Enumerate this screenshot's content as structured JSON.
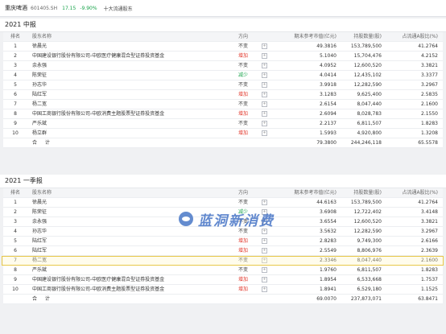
{
  "header": {
    "name": "重庆啤酒",
    "code": "601405.SH",
    "price": "17.15",
    "change": "-9.90%",
    "holder_tab": "十大流通股东"
  },
  "sections": [
    {
      "title": "2021 中报",
      "columns": [
        "排名",
        "股东名称",
        "方向",
        "",
        "期末参考市值(亿元)",
        "持股数量(股)",
        "占流通A股比(%)"
      ],
      "rows": [
        {
          "rank": "1",
          "name": "徐晨光",
          "dir": "不变",
          "type": "unchanged",
          "value": "49.3816",
          "shares": "153,789,500",
          "pct": "41.2764"
        },
        {
          "rank": "2",
          "name": "中国建设银行股份有限公司-中欧医疗健康混合型证券投资基金",
          "dir": "增加",
          "type": "up",
          "value": "5.1040",
          "shares": "15,704,476",
          "pct": "4.2152"
        },
        {
          "rank": "3",
          "name": "余永强",
          "dir": "不变",
          "type": "unchanged",
          "value": "4.0952",
          "shares": "12,600,520",
          "pct": "3.3821"
        },
        {
          "rank": "4",
          "name": "陈荣征",
          "dir": "减少",
          "type": "down",
          "value": "4.0414",
          "shares": "12,435,102",
          "pct": "3.3377"
        },
        {
          "rank": "5",
          "name": "孙志华",
          "dir": "不变",
          "type": "unchanged",
          "value": "3.9918",
          "shares": "12,282,590",
          "pct": "3.2967"
        },
        {
          "rank": "6",
          "name": "陆红军",
          "dir": "增加",
          "type": "up",
          "value": "3.1283",
          "shares": "9,625,400",
          "pct": "2.5835"
        },
        {
          "rank": "7",
          "name": "杨二宽",
          "dir": "不变",
          "type": "unchanged",
          "value": "2.6154",
          "shares": "8,047,440",
          "pct": "2.1600"
        },
        {
          "rank": "8",
          "name": "中国工商银行股份有限公司-中欧消费主题股票型证券投资基金",
          "dir": "增加",
          "type": "up",
          "value": "2.6094",
          "shares": "8,028,783",
          "pct": "2.1550"
        },
        {
          "rank": "9",
          "name": "严乐斌",
          "dir": "不变",
          "type": "unchanged",
          "value": "2.2137",
          "shares": "6,811,507",
          "pct": "1.8283"
        },
        {
          "rank": "10",
          "name": "杨立群",
          "dir": "增加",
          "type": "up",
          "value": "1.5993",
          "shares": "4,920,800",
          "pct": "1.3208"
        }
      ],
      "total": {
        "label": "合 计",
        "value": "79.3800",
        "shares": "244,246,118",
        "pct": "65.5578"
      }
    },
    {
      "title": "2021 一季报",
      "columns": [
        "排名",
        "股东名称",
        "方向",
        "",
        "期末参考市值(亿元)",
        "持股数量(股)",
        "占流通A股比(%)"
      ],
      "rows": [
        {
          "rank": "1",
          "name": "徐晨光",
          "dir": "不变",
          "type": "unchanged",
          "value": "44.6163",
          "shares": "153,789,500",
          "pct": "41.2764"
        },
        {
          "rank": "2",
          "name": "陈荣征",
          "dir": "减少",
          "type": "down",
          "value": "3.6908",
          "shares": "12,722,402",
          "pct": "3.4148"
        },
        {
          "rank": "3",
          "name": "余永强",
          "dir": "不变",
          "type": "unchanged",
          "value": "3.6554",
          "shares": "12,600,520",
          "pct": "3.3821"
        },
        {
          "rank": "4",
          "name": "孙志华",
          "dir": "不变",
          "type": "unchanged",
          "value": "3.5632",
          "shares": "12,282,590",
          "pct": "3.2967"
        },
        {
          "rank": "5",
          "name": "陆红军",
          "dir": "增加",
          "type": "up",
          "value": "2.8283",
          "shares": "9,749,300",
          "pct": "2.6166",
          "highlight": true
        },
        {
          "rank": "6",
          "name": "陆红军",
          "dir": "增加",
          "type": "up",
          "value": "2.5549",
          "shares": "8,806,976",
          "pct": "2.3639"
        },
        {
          "rank": "7",
          "name": "杨二宽",
          "dir": "不变",
          "type": "unchanged",
          "value": "2.3346",
          "shares": "8,047,440",
          "pct": "2.1600"
        },
        {
          "rank": "8",
          "name": "严乐斌",
          "dir": "不变",
          "type": "unchanged",
          "value": "1.9760",
          "shares": "6,811,507",
          "pct": "1.8283"
        },
        {
          "rank": "9",
          "name": "中国建设银行股份有限公司-中欧医疗健康混合型证券投资基金",
          "dir": "增加",
          "type": "up",
          "value": "1.8954",
          "shares": "6,533,668",
          "pct": "1.7537"
        },
        {
          "rank": "10",
          "name": "中国工商银行股份有限公司-中欧消费主题股票型证券投资基金",
          "dir": "增加",
          "type": "up",
          "value": "1.8941",
          "shares": "6,529,180",
          "pct": "1.1525"
        }
      ],
      "total": {
        "label": "合 计",
        "value": "69.0070",
        "shares": "237,873,071",
        "pct": "63.8471"
      }
    }
  ],
  "watermark": {
    "text": "蓝洞新消费"
  },
  "colors": {
    "up": "#e23a2e",
    "down": "#17a34a",
    "highlight": "#e8c84a",
    "brand": "#3f6fc4"
  }
}
